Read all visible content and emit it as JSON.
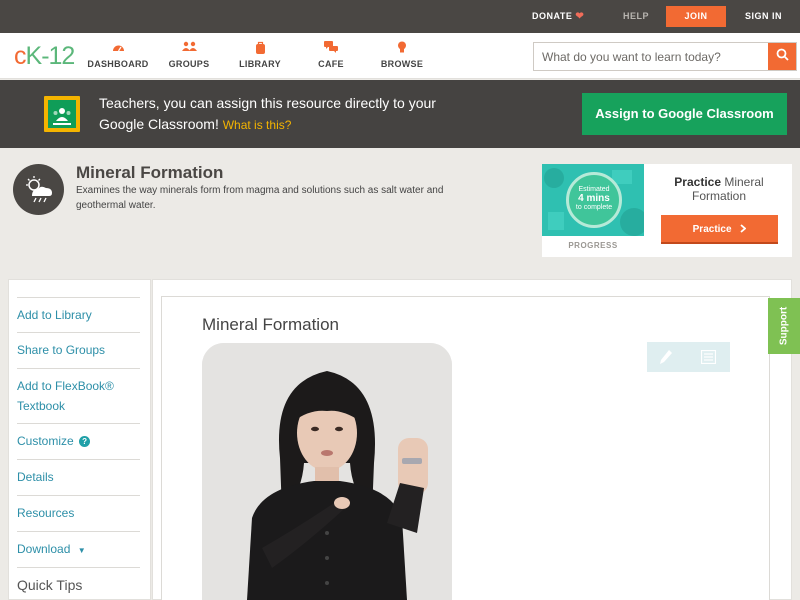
{
  "topbar": {
    "donate": "DONATE",
    "help": "HELP",
    "join": "JOIN",
    "sign_in": "SIGN IN"
  },
  "header": {
    "logo": {
      "c": "c",
      "k": "K",
      "num": "-12"
    },
    "nav": [
      {
        "label": "DASHBOARD",
        "icon": "gauge-icon"
      },
      {
        "label": "GROUPS",
        "icon": "people-icon"
      },
      {
        "label": "LIBRARY",
        "icon": "backpack-icon"
      },
      {
        "label": "CAFE",
        "icon": "chat-bubbles-icon"
      },
      {
        "label": "BROWSE",
        "icon": "lightbulb-icon"
      }
    ],
    "search": {
      "placeholder": "What do you want to learn today?",
      "value": ""
    }
  },
  "google_classroom": {
    "message": "Teachers, you can assign this resource directly to your Google Classroom!",
    "what_link": "What is this?",
    "button": "Assign to Google Classroom"
  },
  "concept": {
    "title": "Mineral Formation",
    "description": "Examines the way minerals form from magma and solutions such as salt water and geothermal water.",
    "icon": "weather-cloud-icon"
  },
  "practice": {
    "estimate_line1": "Estimated",
    "estimate_mins": "4 mins",
    "estimate_line3": "to complete",
    "progress_label": "PROGRESS",
    "title_bold": "Practice",
    "title_rest": "Mineral Formation",
    "button": "Practice"
  },
  "sidebar": {
    "items": [
      {
        "label": "Add to Library"
      },
      {
        "label": "Share to Groups"
      },
      {
        "label": "Add to FlexBook®",
        "label2": "Textbook"
      },
      {
        "label": "Customize"
      },
      {
        "label": "Details"
      },
      {
        "label": "Resources"
      },
      {
        "label": "Download"
      }
    ],
    "quick_tips": "Quick Tips"
  },
  "content": {
    "title": "Mineral Formation"
  },
  "support": "Support",
  "colors": {
    "accent_orange": "#f26a33",
    "brand_green": "#5bb77a",
    "classroom_green": "#17a25c",
    "link_teal": "#2d8fa8"
  }
}
